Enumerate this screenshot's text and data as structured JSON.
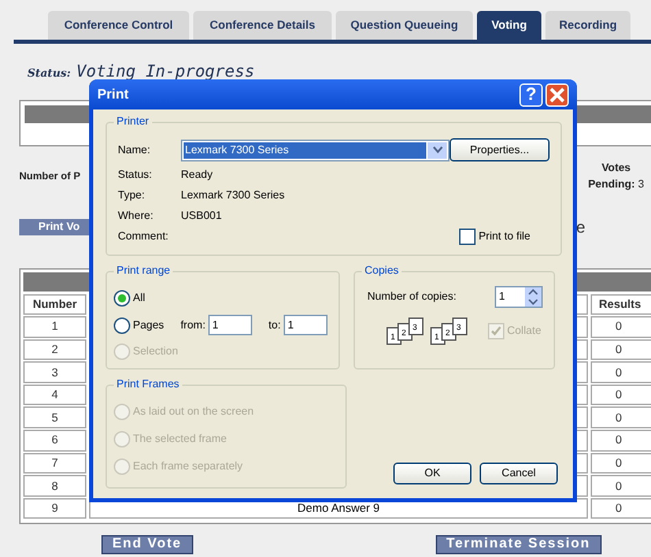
{
  "tabs": [
    {
      "label": "Conference Control",
      "selected": false
    },
    {
      "label": "Conference Details",
      "selected": false
    },
    {
      "label": "Question Queueing",
      "selected": false
    },
    {
      "label": "Voting",
      "selected": true
    },
    {
      "label": "Recording",
      "selected": false
    }
  ],
  "status": {
    "label": "Status:",
    "value": "Voting In-progress"
  },
  "summary": {
    "number_label": "Number of P",
    "votes_pending_label": "Votes",
    "votes_pending_label_2": "Pending:",
    "votes_pending_value": "3",
    "print_button": "Print Vo",
    "column_3_fragment": "e"
  },
  "results_table": {
    "columns": [
      "Number",
      "Results"
    ],
    "rows": [
      {
        "number": "1",
        "results": "0"
      },
      {
        "number": "2",
        "results": "0"
      },
      {
        "number": "3",
        "results": "0"
      },
      {
        "number": "4",
        "results": "0"
      },
      {
        "number": "5",
        "results": "0"
      },
      {
        "number": "6",
        "results": "0"
      },
      {
        "number": "7",
        "results": "0"
      },
      {
        "number": "8",
        "results": "0"
      },
      {
        "number": "9",
        "answer": "Demo Answer 9",
        "results": "0"
      }
    ]
  },
  "buttons": [
    "End Vote",
    "Terminate Session"
  ],
  "print_dialog": {
    "title": "Print",
    "help": "?",
    "printer": {
      "legend": "Printer",
      "name_label": "Name:",
      "name_value": "Lexmark 7300 Series",
      "properties_button": "Properties...",
      "details": [
        {
          "label": "Status:",
          "value": "Ready"
        },
        {
          "label": "Type:",
          "value": "Lexmark 7300 Series"
        },
        {
          "label": "Where:",
          "value": "USB001"
        },
        {
          "label": "Comment:"
        }
      ],
      "print_to_file": {
        "label": "Print to file",
        "checked": false
      }
    },
    "print_range": {
      "legend": "Print range",
      "options": [
        {
          "label": "All",
          "selected": true,
          "disabled": false
        },
        {
          "label": "Pages",
          "selected": false,
          "disabled": false
        },
        {
          "label": "Selection",
          "selected": false,
          "disabled": true
        }
      ],
      "from_label": "from:",
      "from_value": "1",
      "to_label": "to:",
      "to_value": "1"
    },
    "copies": {
      "legend": "Copies",
      "number_label": "Number of copies:",
      "number_value": "1",
      "collate_stacks": [
        [
          "1",
          "2",
          "3"
        ],
        [
          "1",
          "2",
          "3"
        ]
      ],
      "collate": {
        "label": "Collate",
        "checked": true,
        "disabled": true
      }
    },
    "print_frames": {
      "legend": "Print Frames",
      "options": [
        {
          "label": "As laid out on the screen",
          "selected": false,
          "disabled": true
        },
        {
          "label": "The selected frame",
          "selected": false,
          "disabled": true
        },
        {
          "label": "Each frame separately",
          "selected": false,
          "disabled": true
        }
      ]
    },
    "buttons": [
      "OK",
      "Cancel"
    ]
  }
}
